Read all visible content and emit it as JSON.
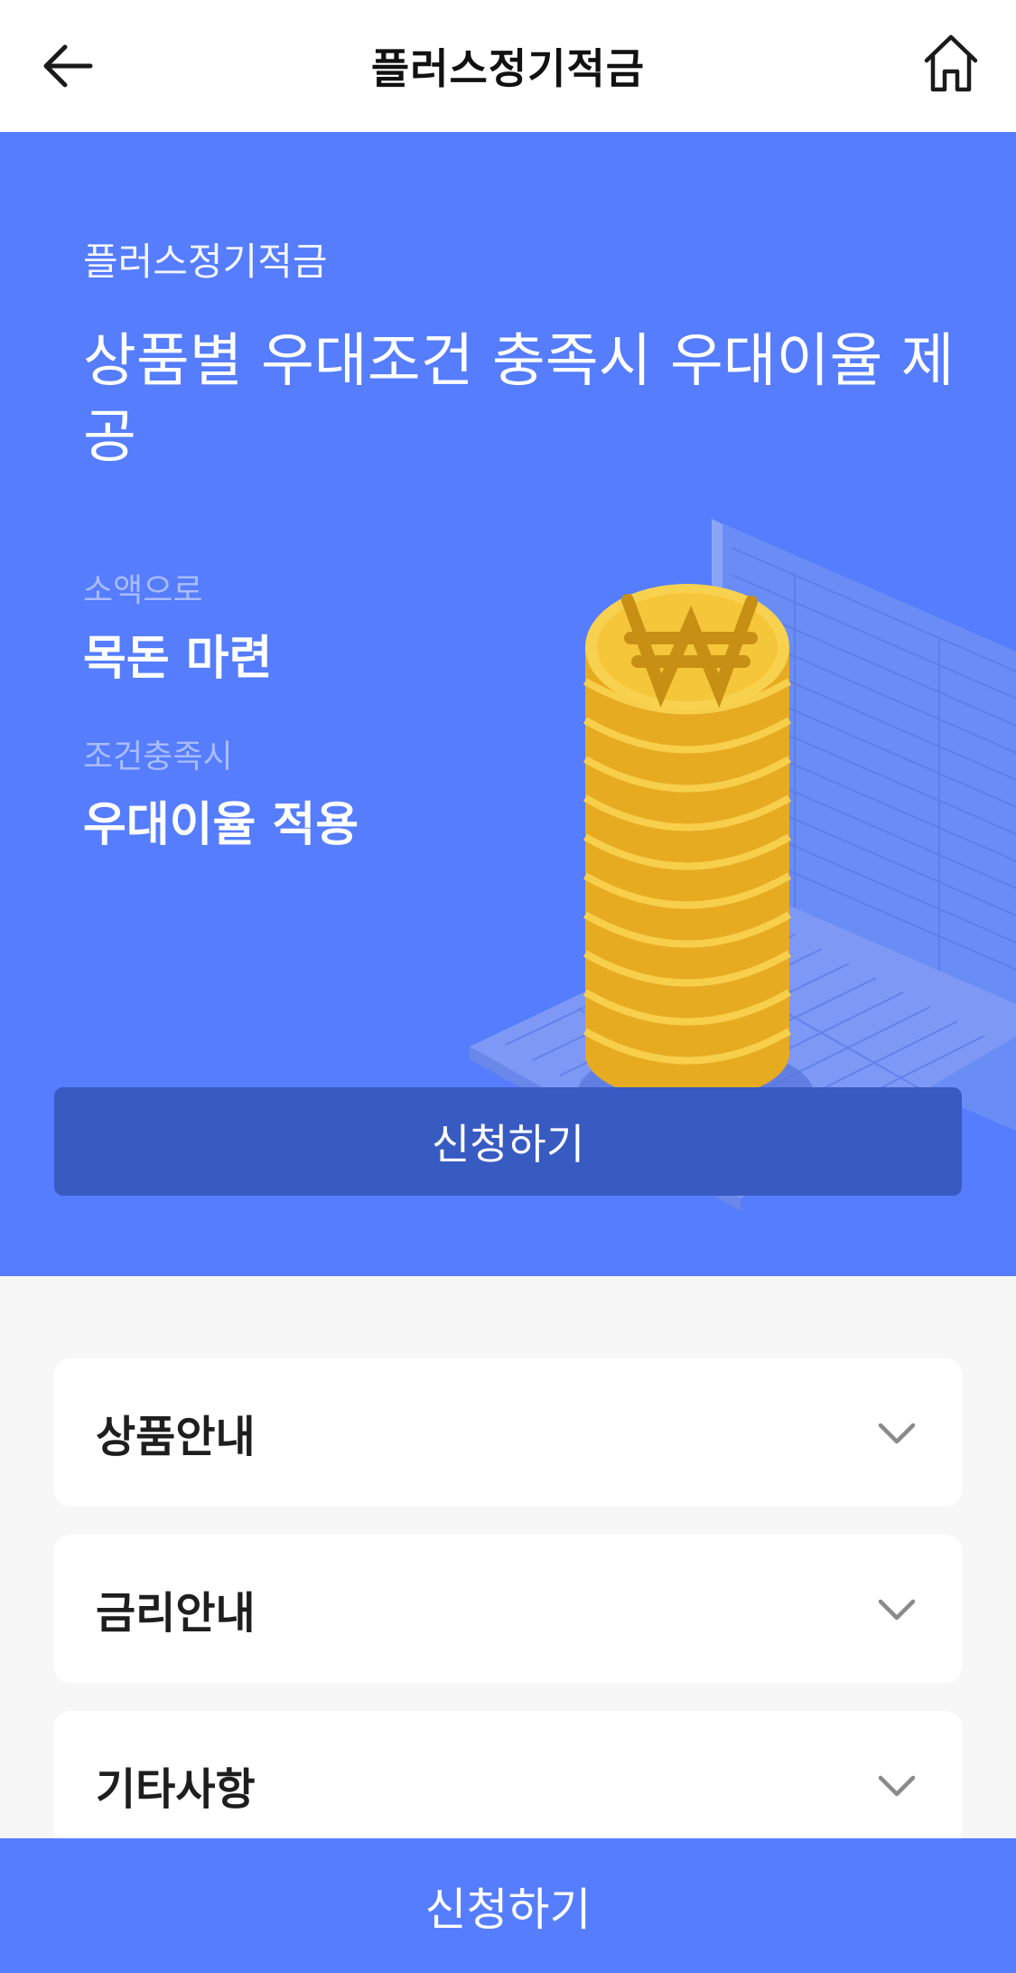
{
  "header": {
    "title": "플러스정기적금",
    "back_icon": "back-arrow-icon",
    "home_icon": "home-icon"
  },
  "hero": {
    "sub_title": "플러스정기적금",
    "headline": "상품별 우대조건 충족시 우대이율 제공",
    "features": [
      {
        "label": "소액으로",
        "value": "목돈 마련"
      },
      {
        "label": "조건충족시",
        "value": "우대이율 적용"
      }
    ],
    "apply_label": "신청하기",
    "illustration": "coin-stack-on-ledger"
  },
  "accordion": [
    {
      "label": "상품안내",
      "icon": "chevron-down-icon"
    },
    {
      "label": "금리안내",
      "icon": "chevron-down-icon"
    },
    {
      "label": "기타사항",
      "icon": "chevron-down-icon"
    }
  ],
  "bottom_bar": {
    "apply_label": "신청하기"
  },
  "colors": {
    "primary": "#557dfd",
    "primary_dark": "#385bc2",
    "coin": "#f5c12e",
    "background": "#f7f7f7"
  }
}
